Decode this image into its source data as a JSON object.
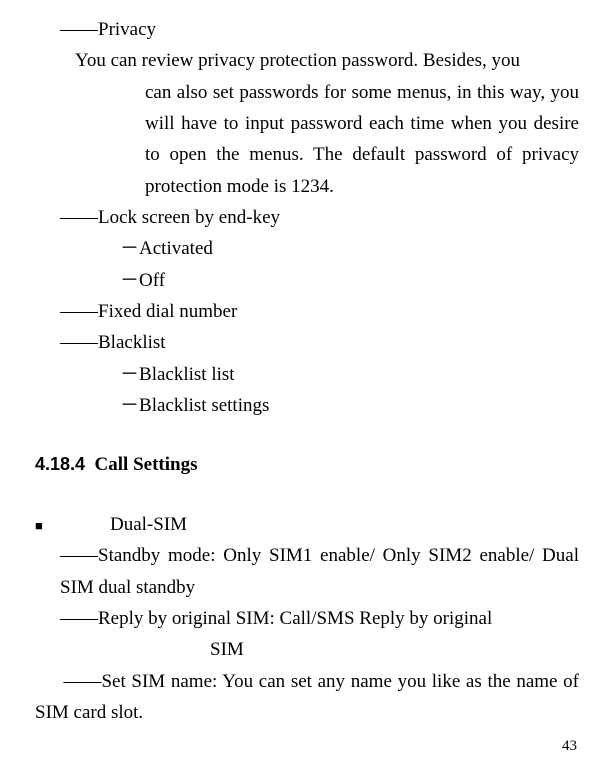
{
  "dash2": "――",
  "dash1": "－",
  "privacy": {
    "label": "Privacy",
    "desc_first": "You can review privacy protection password. Besides, you",
    "desc_rest": "can also set passwords for some menus, in this way, you will have to input password each time when you desire to open the menus. The default password of privacy protection mode is 1234."
  },
  "lockscreen": {
    "label": "Lock screen by end-key",
    "opt1": "Activated",
    "opt2": "Off"
  },
  "fixed": {
    "label": "Fixed dial number"
  },
  "blacklist": {
    "label": "Blacklist",
    "opt1": "Blacklist list",
    "opt2": "Blacklist settings"
  },
  "section": {
    "num": "4.18.4",
    "title": "Call Settings"
  },
  "dualsim": {
    "label": "Dual-SIM",
    "standby": "Standby mode: Only SIM1 enable/ Only SIM2 enable/ Dual SIM dual standby",
    "reply1": "Reply by original SIM: Call/SMS Reply by original",
    "reply2": "SIM",
    "setname": "Set SIM name: You can set any name you like as the name of SIM card slot."
  },
  "pagenum": "43"
}
